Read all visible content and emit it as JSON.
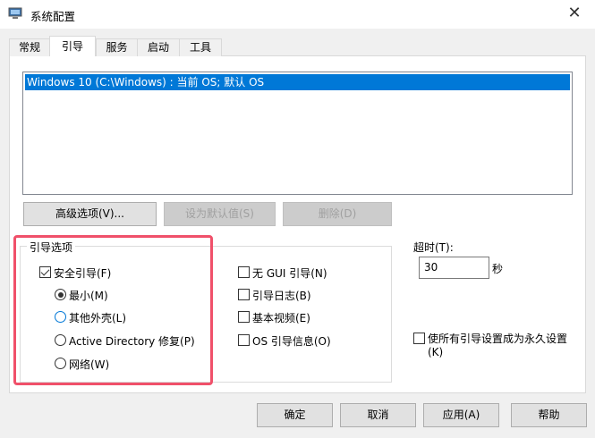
{
  "window": {
    "title": "系统配置",
    "close": "✕"
  },
  "tabs": [
    {
      "label": "常规"
    },
    {
      "label": "引导"
    },
    {
      "label": "服务"
    },
    {
      "label": "启动"
    },
    {
      "label": "工具"
    }
  ],
  "boot_list": {
    "items": [
      "Windows 10 (C:\\Windows) : 当前 OS; 默认 OS"
    ]
  },
  "buttons": {
    "advanced": "高级选项(V)...",
    "set_default": "设为默认值(S)",
    "delete": "删除(D)"
  },
  "boot_options": {
    "title": "引导选项",
    "safe_boot": {
      "label": "安全引导(F)",
      "checked": true
    },
    "radios": [
      {
        "label": "最小(M)",
        "selected": true
      },
      {
        "label": "其他外壳(L)",
        "selected": false
      },
      {
        "label": "Active Directory 修复(P)",
        "selected": false
      },
      {
        "label": "网络(W)",
        "selected": false
      }
    ],
    "checks": [
      {
        "label": "无 GUI 引导(N)",
        "checked": false
      },
      {
        "label": "引导日志(B)",
        "checked": false
      },
      {
        "label": "基本视频(E)",
        "checked": false
      },
      {
        "label": "OS 引导信息(O)",
        "checked": false
      }
    ]
  },
  "timeout": {
    "label": "超时(T):",
    "value": "30",
    "unit": "秒"
  },
  "permanent": {
    "line1": "使所有引导设置成为永久设置",
    "line2": "(K)",
    "checked": false
  },
  "footer": {
    "ok": "确定",
    "cancel": "取消",
    "apply": "应用(A)",
    "help": "帮助"
  },
  "colors": {
    "selection": "#0078d7",
    "highlight": "#f0506a"
  }
}
